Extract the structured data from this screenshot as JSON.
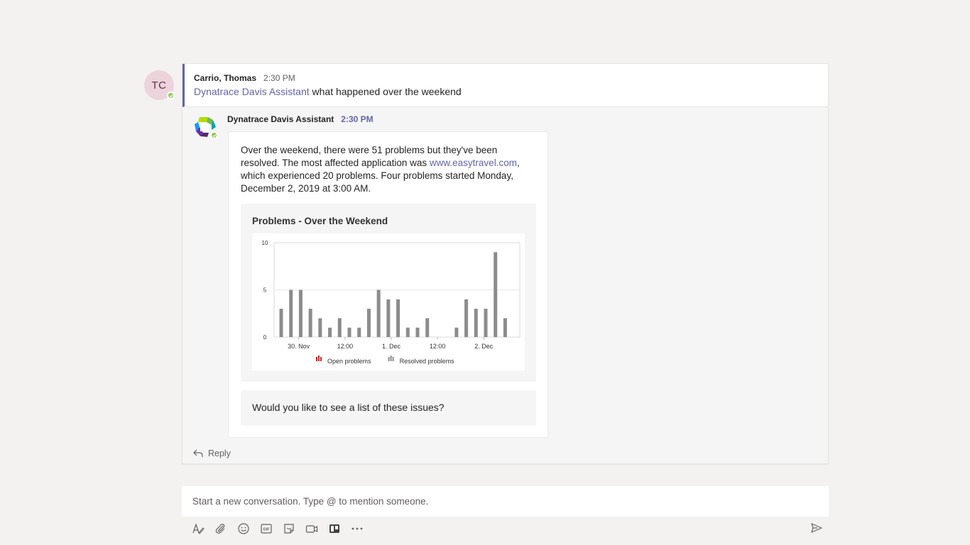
{
  "root_message": {
    "author_initials": "TC",
    "author": "Carrio, Thomas",
    "time": "2:30 PM",
    "mention": "Dynatrace Davis Assistant",
    "text": " what happened over the weekend"
  },
  "reply": {
    "author": "Dynatrace Davis Assistant",
    "time": "2:30 PM",
    "text_before_link": "Over the weekend, there were 51 problems but they've been resolved. The most affected application was ",
    "link": "www.easytravel.com",
    "text_after_link": ", which experienced 20 problems. Four problems started Monday, December 2, 2019 at 3:00 AM.",
    "question": "Would you like to see a list of these issues?",
    "reply_label": "Reply"
  },
  "chart_data": {
    "type": "bar",
    "title": "Problems - Over the Weekend",
    "x_tick_labels": [
      "30. Nov",
      "12:00",
      "1. Dec",
      "12:00",
      "2. Dec"
    ],
    "y_ticks": [
      0,
      5,
      10
    ],
    "ylim": [
      0,
      10
    ],
    "series": [
      {
        "name": "Open problems",
        "color": "#c62828",
        "values": [
          0,
          0,
          0,
          0,
          0,
          0,
          0,
          0,
          0,
          0,
          0,
          0,
          0,
          0,
          0,
          0,
          0,
          0,
          0,
          0,
          0,
          0,
          0,
          0,
          0,
          0
        ]
      },
      {
        "name": "Resolved problems",
        "color": "#8c8c8c",
        "values": [
          3,
          5,
          5,
          3,
          2,
          1,
          2,
          1,
          1,
          3,
          5,
          4,
          4,
          1,
          1,
          2,
          0,
          0,
          1,
          4,
          3,
          3,
          9,
          2
        ]
      }
    ],
    "legend": "bottom",
    "grid": true
  },
  "compose": {
    "placeholder": "Start a new conversation. Type @ to mention someone."
  },
  "toolbar": {
    "icons": [
      "format-icon",
      "attach-icon",
      "emoji-icon",
      "gif-icon",
      "sticker-icon",
      "meet-icon",
      "trello-icon",
      "more-icon"
    ],
    "send_icon": "send-icon"
  },
  "colors": {
    "accent": "#6264a7",
    "presence": "#92c353",
    "avatar_bg": "#ecd4dc"
  }
}
